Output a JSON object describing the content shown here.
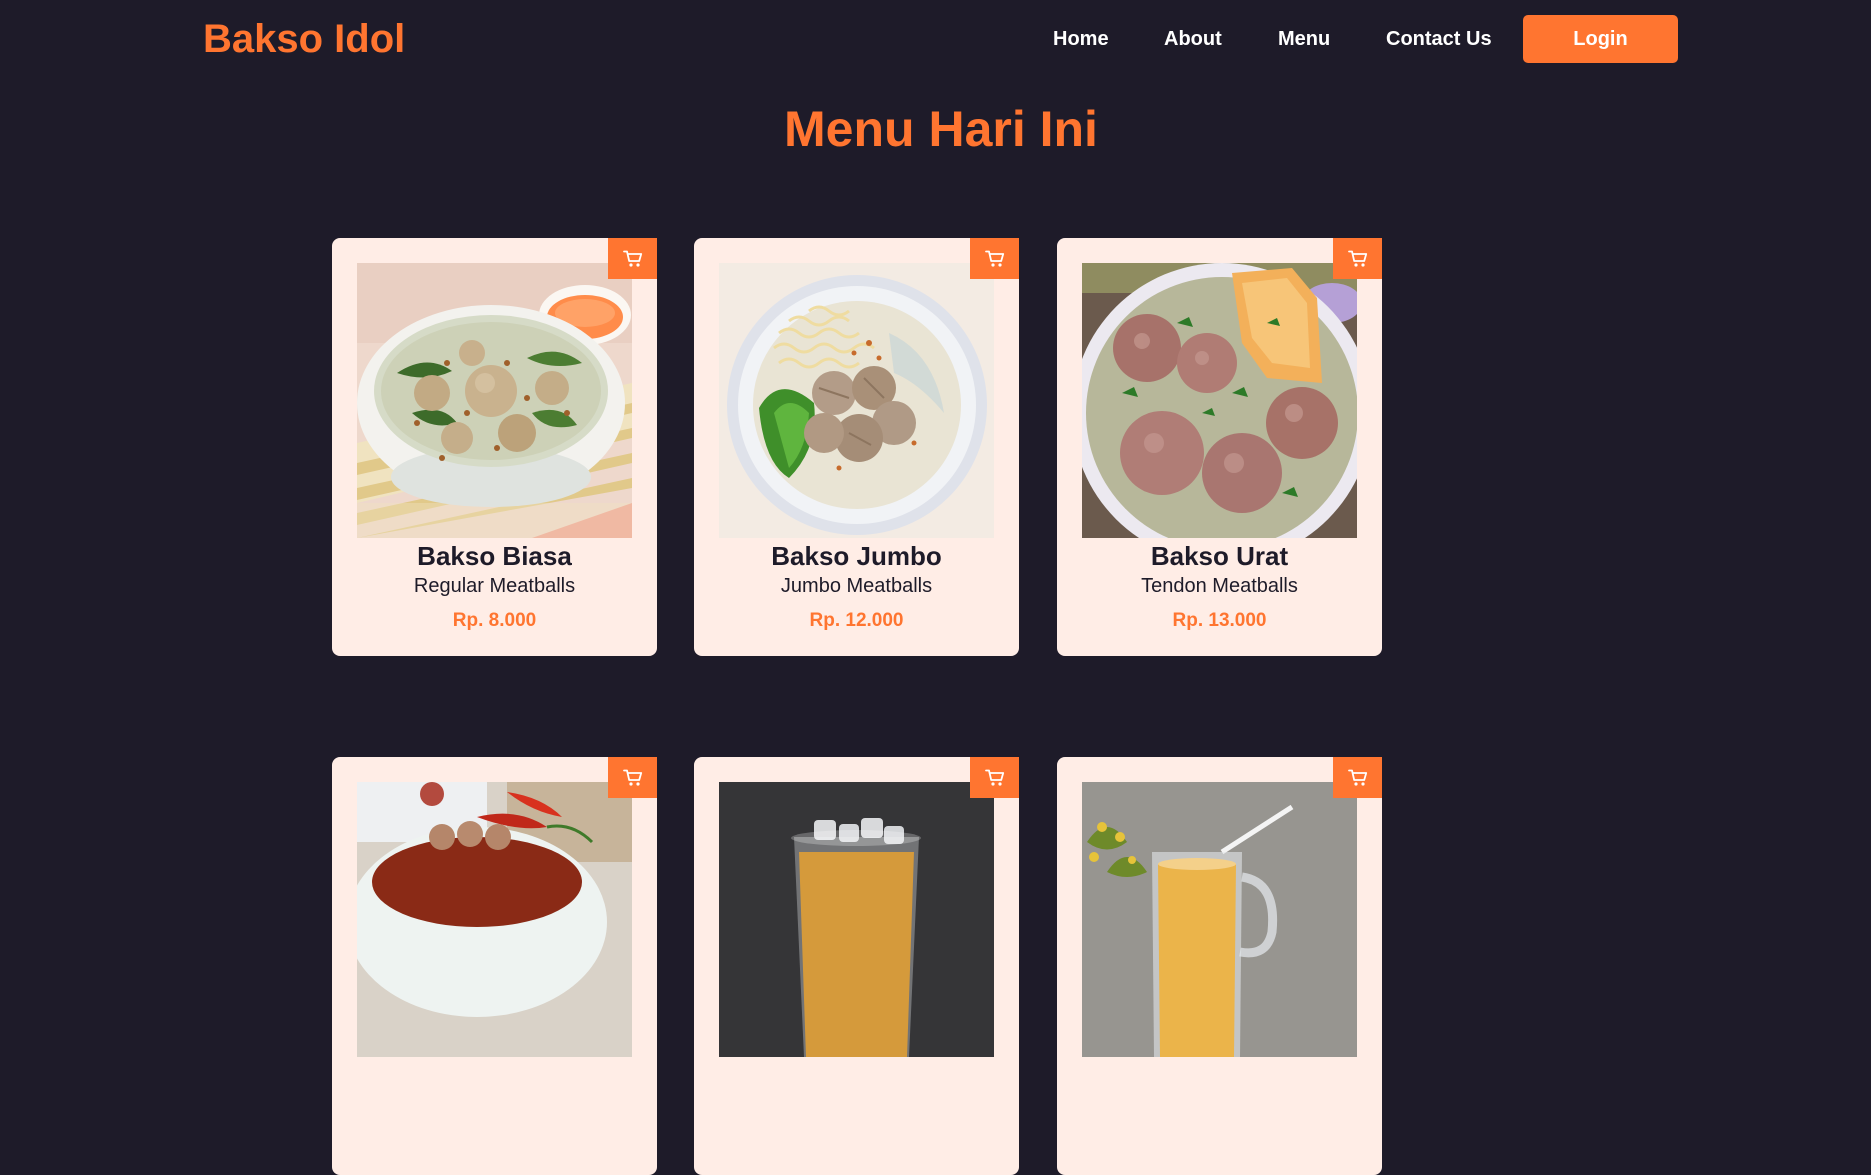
{
  "navbar": {
    "brand": "Bakso Idol",
    "links": [
      {
        "label": "Home"
      },
      {
        "label": "About"
      },
      {
        "label": "Menu"
      },
      {
        "label": "Contact Us"
      }
    ],
    "login_label": "Login"
  },
  "page": {
    "title": "Menu Hari Ini"
  },
  "menu": {
    "items": [
      {
        "name": "Bakso Biasa",
        "description": "Regular Meatballs",
        "price": "Rp. 8.000"
      },
      {
        "name": "Bakso Jumbo",
        "description": "Jumbo Meatballs",
        "price": "Rp. 12.000"
      },
      {
        "name": "Bakso Urat",
        "description": "Tendon Meatballs",
        "price": "Rp. 13.000"
      },
      {},
      {},
      {}
    ]
  },
  "icons": {
    "cart": "cart-icon"
  },
  "colors": {
    "background": "#1e1b29",
    "accent": "#ff7530",
    "card": "#ffede6",
    "text_dark": "#1e1b29",
    "text_light": "#ffffff"
  }
}
